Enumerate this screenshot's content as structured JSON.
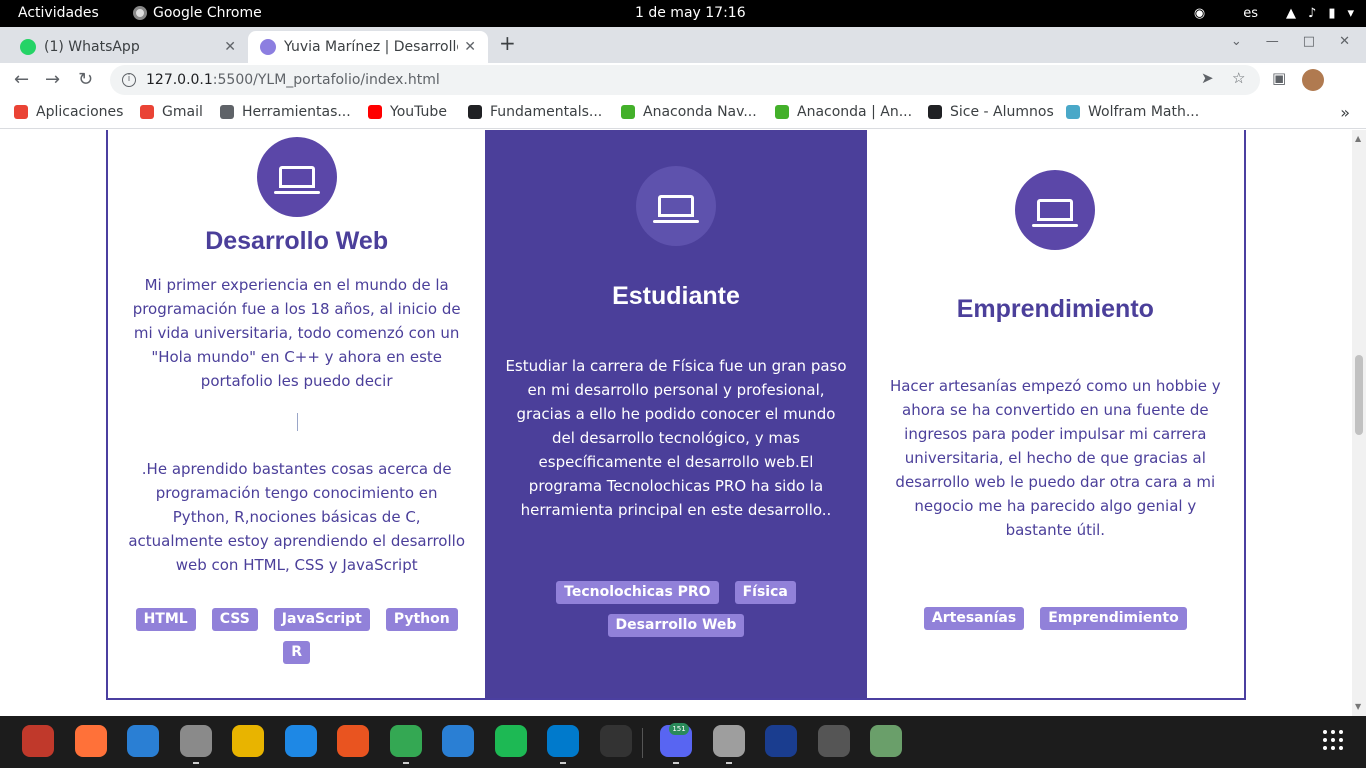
{
  "system_bar": {
    "activities": "Actividades",
    "app_name": "Google Chrome",
    "clock": "1 de may  17:16",
    "language": "es"
  },
  "browser": {
    "tabs": [
      {
        "title": "(1) WhatsApp",
        "favicon_color": "#25d366",
        "active": false
      },
      {
        "title": "Yuvia Marínez | Desarrollo",
        "favicon_color": "#8c7ee0",
        "active": true
      }
    ],
    "url_host": "127.0.0.1",
    "url_path": ":5500/YLM_portafolio/index.html",
    "bookmarks": [
      {
        "label": "Aplicaciones",
        "icon": "apps-grid-icon",
        "color": "#ea4335"
      },
      {
        "label": "Gmail",
        "icon": "gmail-icon",
        "color": "#ea4335"
      },
      {
        "label": "Herramientas...",
        "icon": "folder-icon",
        "color": "#5f6368"
      },
      {
        "label": "YouTube",
        "icon": "youtube-icon",
        "color": "#ff0000"
      },
      {
        "label": "Fundamentals...",
        "icon": "globe-icon",
        "color": "#202124"
      },
      {
        "label": "Anaconda Nav...",
        "icon": "anaconda-icon",
        "color": "#43b02a"
      },
      {
        "label": "Anaconda | An...",
        "icon": "anaconda-icon",
        "color": "#43b02a"
      },
      {
        "label": "Sice - Alumnos",
        "icon": "globe-icon",
        "color": "#202124"
      },
      {
        "label": "Wolfram Math...",
        "icon": "wolfram-icon",
        "color": "#4aa8c8"
      }
    ]
  },
  "page": {
    "accent_color": "#4b3f9a",
    "tag_color": "#9181d9",
    "cards": [
      {
        "title": "Desarrollo Web",
        "text1": "Mi primer experiencia en el mundo de la programación fue a los 18 años, al inicio de mi vida universitaria, todo comenzó con un \"Hola mundo\" en C++ y ahora en este portafolio les puedo decir",
        "text2": ".He aprendido bastantes cosas acerca de programación tengo conocimiento en Python, R,nociones básicas de C, actualmente estoy aprendiendo el desarrollo web con HTML, CSS y JavaScript",
        "tags": [
          "HTML",
          "CSS",
          "JavaScript",
          "Python",
          "R"
        ]
      },
      {
        "title": "Estudiante",
        "text1": "Estudiar la carrera de Física fue un gran paso en mi desarrollo personal y profesional, gracias a ello he podido conocer el mundo del desarrollo tecnológico, y mas específicamente el desarrollo web.El programa Tecnolochicas PRO ha sido la herramienta principal en este desarrollo..",
        "tags": [
          "Tecnolochicas PRO",
          "Física",
          "Desarrollo Web"
        ]
      },
      {
        "title": "Emprendimiento",
        "text1": "Hacer artesanías empezó como un hobbie y ahora se ha convertido en una fuente de ingresos para poder impulsar mi carrera universitaria, el hecho de que gracias al desarrollo web le puedo dar otra cara a mi negocio me ha parecido algo genial y bastante útil.",
        "tags": [
          "Artesanías",
          "Emprendimiento"
        ]
      }
    ]
  },
  "dock": {
    "discord_badge": "151",
    "items": [
      {
        "name": "screenshot-app-icon",
        "color": "#c0392b",
        "running": false
      },
      {
        "name": "firefox-icon",
        "color": "#ff7139",
        "running": false
      },
      {
        "name": "thunderbird-icon",
        "color": "#2a7fd4",
        "running": false
      },
      {
        "name": "files-icon",
        "color": "#8a8a8a",
        "running": true
      },
      {
        "name": "rhythmbox-icon",
        "color": "#e8b400",
        "running": false
      },
      {
        "name": "writer-icon",
        "color": "#1e88e5",
        "running": false
      },
      {
        "name": "software-center-icon",
        "color": "#e95420",
        "running": false
      },
      {
        "name": "chrome-icon",
        "color": "#34a853",
        "running": true
      },
      {
        "name": "help-icon",
        "color": "#2a7fd4",
        "running": false
      },
      {
        "name": "spotify-icon",
        "color": "#1db954",
        "running": false
      },
      {
        "name": "vscode-icon",
        "color": "#007acc",
        "running": true
      },
      {
        "name": "terminal-icon",
        "color": "#333333",
        "running": false
      },
      {
        "name": "discord-icon",
        "color": "#5865f2",
        "running": true
      },
      {
        "name": "image-viewer-icon",
        "color": "#9e9e9e",
        "running": true
      },
      {
        "name": "kicad-icon",
        "color": "#1a3d8f",
        "running": false
      },
      {
        "name": "ssd-drive-icon",
        "color": "#555555",
        "running": false
      },
      {
        "name": "trash-icon",
        "color": "#6a9f6a",
        "running": false
      }
    ]
  }
}
